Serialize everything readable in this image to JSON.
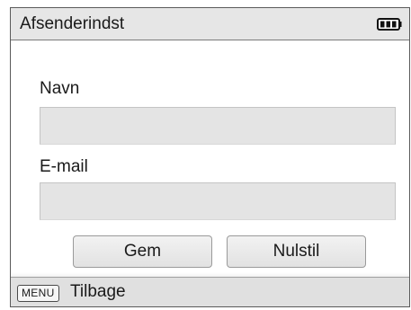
{
  "header": {
    "title": "Afsenderindst",
    "battery_icon": "battery-full-icon"
  },
  "form": {
    "name_label": "Navn",
    "name_value": "",
    "email_label": "E-mail",
    "email_value": ""
  },
  "buttons": {
    "save_label": "Gem",
    "reset_label": "Nulstil"
  },
  "footer": {
    "menu_key_label": "MENU",
    "back_label": "Tilbage"
  }
}
